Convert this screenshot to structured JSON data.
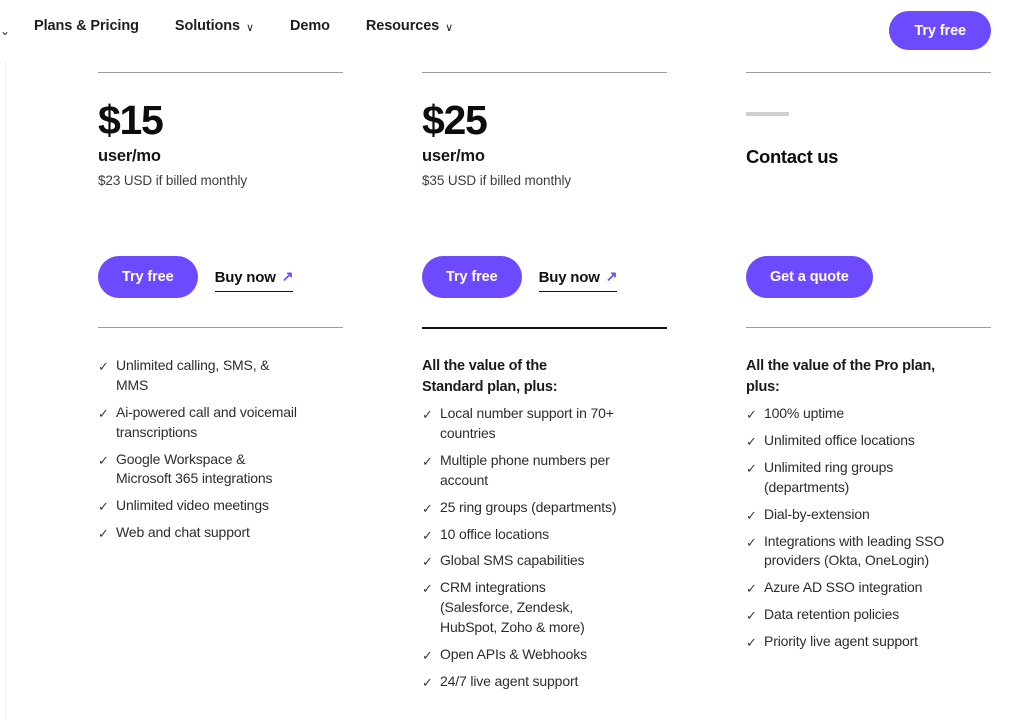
{
  "nav": {
    "cut_off_chevron": "⌄",
    "items": [
      {
        "label": "Plans & Pricing",
        "has_chevron": false
      },
      {
        "label": "Solutions",
        "has_chevron": true
      },
      {
        "label": "Demo",
        "has_chevron": false
      },
      {
        "label": "Resources",
        "has_chevron": true
      }
    ],
    "chevron_glyph": "∨",
    "cta_label": "Try free"
  },
  "colors": {
    "accent_purple": "#6D4AFF",
    "text_primary": "#111111",
    "text_secondary": "#3D3D3D",
    "rule_gray": "#9B9B9B",
    "rule_black": "#111111",
    "placeholder_dash": "#CFCFCF"
  },
  "icons": {
    "check": "✓",
    "arrow_up_right": "↗"
  },
  "plans": [
    {
      "price": "$15",
      "period": "user/mo",
      "billed_note": "$23 USD if billed monthly",
      "primary_cta": "Try free",
      "secondary_cta": "Buy now",
      "feature_heading": "",
      "features": [
        "Unlimited calling, SMS, & MMS",
        "Ai-powered call and voicemail transcriptions",
        "Google Workspace & Microsoft 365 integrations",
        "Unlimited video meetings",
        "Web and chat support"
      ]
    },
    {
      "price": "$25",
      "period": "user/mo",
      "billed_note": "$35 USD if billed monthly",
      "primary_cta": "Try free",
      "secondary_cta": "Buy now",
      "feature_heading": "All the value of the Standard plan, plus:",
      "features": [
        "Local number support in 70+ countries",
        "Multiple phone numbers per account",
        "25 ring groups (departments)",
        "10 office locations",
        "Global SMS capabilities",
        "CRM integrations (Salesforce, Zendesk, HubSpot, Zoho & more)",
        "Open APIs & Webhooks",
        "24/7 live agent support"
      ]
    },
    {
      "price": "",
      "period": "",
      "billed_note": "",
      "contact_title": "Contact us",
      "primary_cta": "Get a quote",
      "secondary_cta": "",
      "feature_heading": "All the value of the Pro plan, plus:",
      "features": [
        "100% uptime",
        "Unlimited office locations",
        "Unlimited ring groups (departments)",
        "Dial-by-extension",
        "Integrations with leading SSO providers (Okta, OneLogin)",
        "Azure AD SSO integration",
        "Data retention policies",
        "Priority live agent support"
      ]
    }
  ]
}
